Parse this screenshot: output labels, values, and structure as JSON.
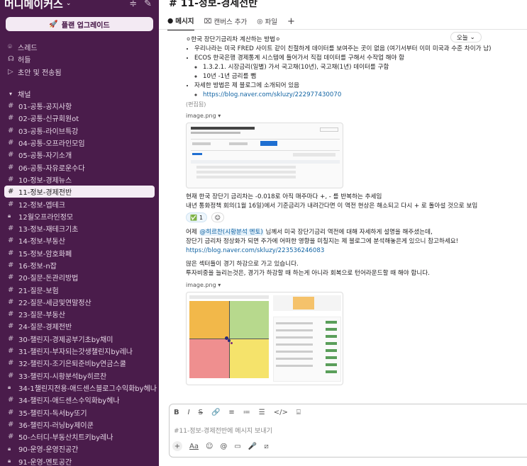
{
  "sidebar": {
    "workspace_name": "머니메이커스",
    "upgrade_label": "플랜 업그레이드",
    "nav": [
      {
        "icon": "threads-icon",
        "label": "스레드"
      },
      {
        "icon": "huddle-icon",
        "label": "허들"
      },
      {
        "icon": "send-icon",
        "label": "초안 및 전송됨"
      }
    ],
    "channels_header": "채널",
    "channels": [
      {
        "label": "01-공통-공지사항",
        "icon": "#"
      },
      {
        "label": "02-공통-신규회원ot",
        "icon": "#"
      },
      {
        "label": "03-공통-라이브특강",
        "icon": "#"
      },
      {
        "label": "04-공통-오프라인모임",
        "icon": "#"
      },
      {
        "label": "05-공통-자기소개",
        "icon": "#"
      },
      {
        "label": "06-공통-자유로운수다",
        "icon": "#"
      },
      {
        "label": "10-정보-경제뉴스",
        "icon": "#"
      },
      {
        "label": "11-정보-경제전반",
        "icon": "#",
        "active": true
      },
      {
        "label": "12-정보-엡테크",
        "icon": "#"
      },
      {
        "label": "12월오프라인정모",
        "icon": "lock"
      },
      {
        "label": "13-정보-재테크기초",
        "icon": "#"
      },
      {
        "label": "14-정보-부동산",
        "icon": "#"
      },
      {
        "label": "15-정보-암호화폐",
        "icon": "#"
      },
      {
        "label": "16-정보-n잡",
        "icon": "#"
      },
      {
        "label": "20-질문-돈관리방법",
        "icon": "#"
      },
      {
        "label": "21-질문-보험",
        "icon": "#"
      },
      {
        "label": "22-질문-세금및연말정산",
        "icon": "#"
      },
      {
        "label": "23-질문-부동산",
        "icon": "#"
      },
      {
        "label": "24-질문-경제전반",
        "icon": "#"
      },
      {
        "label": "30-챌린지-경제공부기초by채미",
        "icon": "#"
      },
      {
        "label": "31-챌린지-부자되는갓생챌린지by레나",
        "icon": "#"
      },
      {
        "label": "32-챌린지-조기은퇴준비by연금스쿨",
        "icon": "#"
      },
      {
        "label": "33-챌린지-시황분석by히르찬",
        "icon": "#"
      },
      {
        "label": "34-1챌린지전용-애드센스블로그수익화by헤나",
        "icon": "lock"
      },
      {
        "label": "34-챌린지-애드센스수익화by헤나",
        "icon": "#"
      },
      {
        "label": "35-챌린지-독서by또기",
        "icon": "#"
      },
      {
        "label": "36-챌린지-러닝by제이쿤",
        "icon": "#"
      },
      {
        "label": "50-스터디-부동산치트키by레나",
        "icon": "#"
      },
      {
        "label": "90-운영-운영진공간",
        "icon": "lock"
      },
      {
        "label": "91-운영-멘토공간",
        "icon": "lock"
      }
    ]
  },
  "main": {
    "channel_title": "# 11-정보-경제전반",
    "tabs": [
      {
        "icon": "message-icon",
        "label": "메시지",
        "active": true
      },
      {
        "icon": "canvas-icon",
        "label": "캔버스 추가"
      },
      {
        "icon": "file-icon",
        "label": "파일"
      },
      {
        "icon": "plus-icon",
        "label": "+"
      }
    ],
    "day_label": "오늘",
    "message1": {
      "heading": "⚪한국 장단기금리차 계산하는 방법⚪",
      "bullets": [
        "우리나라는 미국 FRED 사이트 같이 친절하게 데이터를 보여주는 곳이 없음 (여기서부터 이미 미국과 수준 차이가 남)",
        "ECOS 한국은행 경제통계 시스템에 들어가서 직접 데이터를 구해서 수작업 해야 함"
      ],
      "sub_bullets": [
        "1.3.2.1.  시장금리(일별) 가서 국고채(10년), 국고채(1년) 데이터를 구함",
        "10년 -1년 금리를 뺌"
      ],
      "bullet3": "자세한 방법은 제 블로그에 소개되어 있음",
      "link1": "https://blog.naver.com/skluzy/222977430070",
      "edited": "(편집됨)",
      "attachment1": "image.png",
      "after_image": [
        "현재 한국 장단기 금리차는 -0.018로 아직 매주마다 +, - 를 반복하는 추세임",
        "내년 통화정책 회의(1월 16일)에서 기준금리가 내려간다면 이 역전 현상은 해소되고 다시 + 로 돌아설 것으로 보임"
      ],
      "reaction_emoji": "✅",
      "reaction_count": "1"
    },
    "message2": {
      "prefix": "어제 ",
      "mention": "@히르찬(시황분석 멘토)",
      "suffix": " 님께서 미국 장단기금리 역전에 대해 자세하게 설명을 해주셨는데,",
      "line2": "장단기 금리차 정상화가 되면 주가에 어떠한 영향을 미칠지는 제 블로그에 분석해놓은게 있으니 참고하세요!",
      "link2": "https://blog.naver.com/skluzy/223536246083",
      "line3": "많은 섹터들이 경기 하강으로 가고 있습니다.",
      "line4": "투자비중을 늘리는것은, 경기가 하강할 때 하는게 아니라 회복으로 턴어라운드할 때 해야 합니다.",
      "attachment2": "image.png"
    },
    "composer": {
      "placeholder": "#11-정보-경제전반에 메시지 보내기",
      "format_buttons": [
        "B",
        "I",
        "S",
        "🔗",
        "≡",
        "≔",
        "☰",
        "</>",
        "⌸"
      ],
      "bottom_tools": [
        "+",
        "Aa",
        "☺",
        "@",
        "▭",
        "🎤",
        "⧄"
      ]
    }
  },
  "colors": {
    "sidebar_bg": "#4a1c4b",
    "link": "#1264a3",
    "active_channel_bg": "#f4ecf4"
  }
}
